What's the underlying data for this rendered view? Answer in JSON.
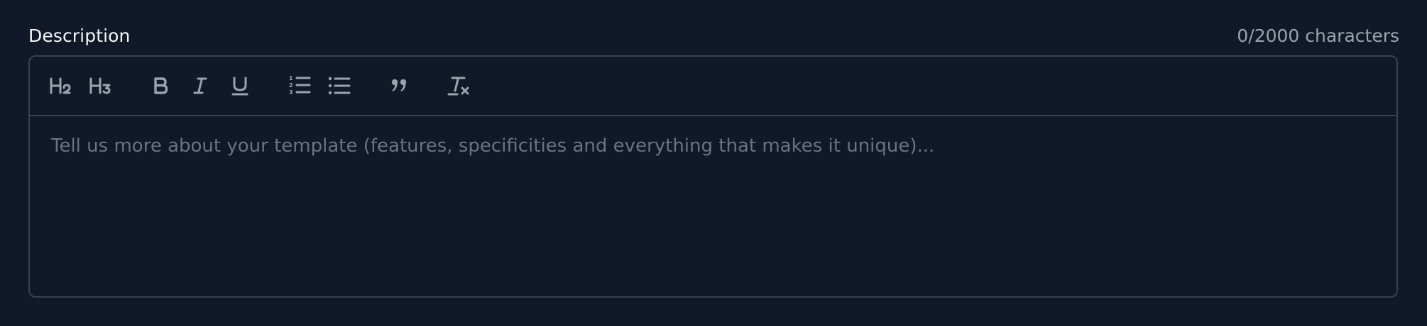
{
  "field": {
    "label": "Description",
    "counter": "0/2000 characters"
  },
  "editor": {
    "placeholder": "Tell us more about your template (features, specificities and everything that makes it unique)...",
    "value": "",
    "toolbar": [
      {
        "name": "heading-2",
        "icon": "heading-2-icon"
      },
      {
        "name": "heading-3",
        "icon": "heading-3-icon"
      },
      {
        "name": "bold",
        "icon": "bold-icon"
      },
      {
        "name": "italic",
        "icon": "italic-icon"
      },
      {
        "name": "underline",
        "icon": "underline-icon"
      },
      {
        "name": "ordered-list",
        "icon": "ordered-list-icon"
      },
      {
        "name": "bullet-list",
        "icon": "bullet-list-icon"
      },
      {
        "name": "blockquote",
        "icon": "quote-icon"
      },
      {
        "name": "clear-formatting",
        "icon": "clear-format-icon"
      }
    ]
  },
  "colors": {
    "background": "#111827",
    "border": "#374151",
    "icon": "#9ca3af",
    "placeholder": "#6b7280"
  }
}
